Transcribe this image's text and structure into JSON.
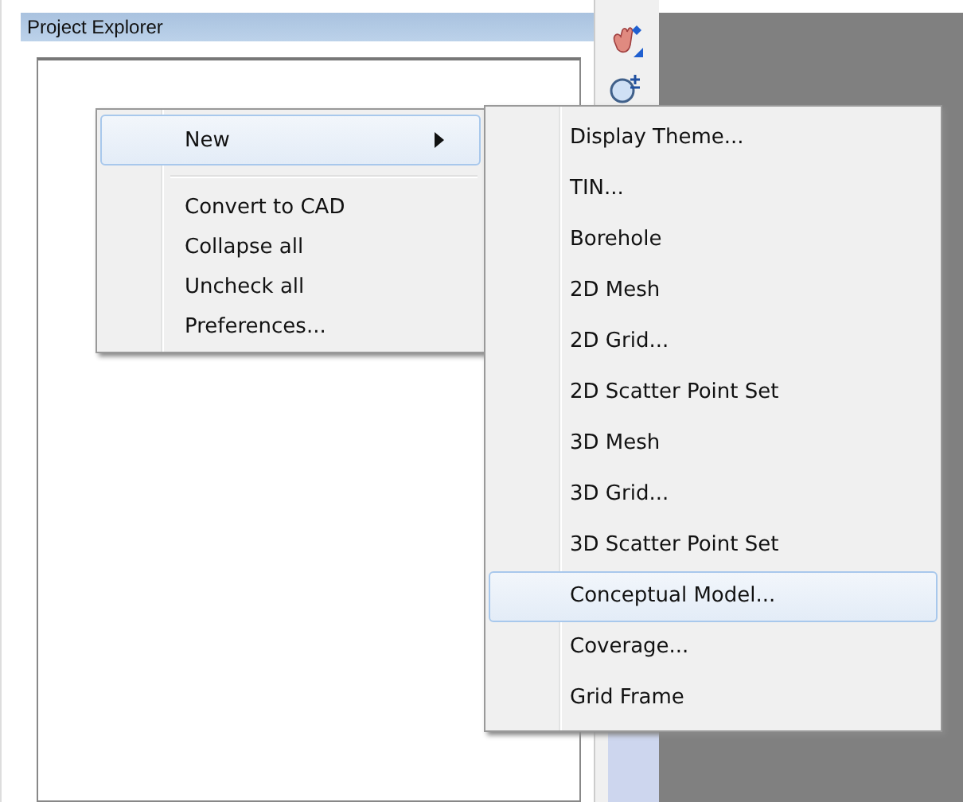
{
  "panel": {
    "title": "Project Explorer"
  },
  "context_menu": {
    "items": [
      {
        "kind": "item",
        "label": "New",
        "selected": true,
        "submenu": true
      },
      {
        "kind": "separator"
      },
      {
        "kind": "item",
        "label": "Convert to CAD",
        "selected": false,
        "submenu": false
      },
      {
        "kind": "item",
        "label": "Collapse all",
        "selected": false,
        "submenu": false
      },
      {
        "kind": "item",
        "label": "Uncheck all",
        "selected": false,
        "submenu": false
      },
      {
        "kind": "item",
        "label": "Preferences...",
        "selected": false,
        "submenu": false
      }
    ]
  },
  "submenu": {
    "items": [
      {
        "label": "Display Theme...",
        "selected": false
      },
      {
        "label": "TIN...",
        "selected": false
      },
      {
        "label": "Borehole",
        "selected": false
      },
      {
        "label": "2D Mesh",
        "selected": false
      },
      {
        "label": "2D Grid...",
        "selected": false
      },
      {
        "label": "2D Scatter Point Set",
        "selected": false
      },
      {
        "label": "3D Mesh",
        "selected": false
      },
      {
        "label": "3D Grid...",
        "selected": false
      },
      {
        "label": "3D Scatter Point Set",
        "selected": false
      },
      {
        "label": "Conceptual Model...",
        "selected": true
      },
      {
        "label": "Coverage...",
        "selected": false
      },
      {
        "label": "Grid Frame",
        "selected": false
      }
    ]
  }
}
